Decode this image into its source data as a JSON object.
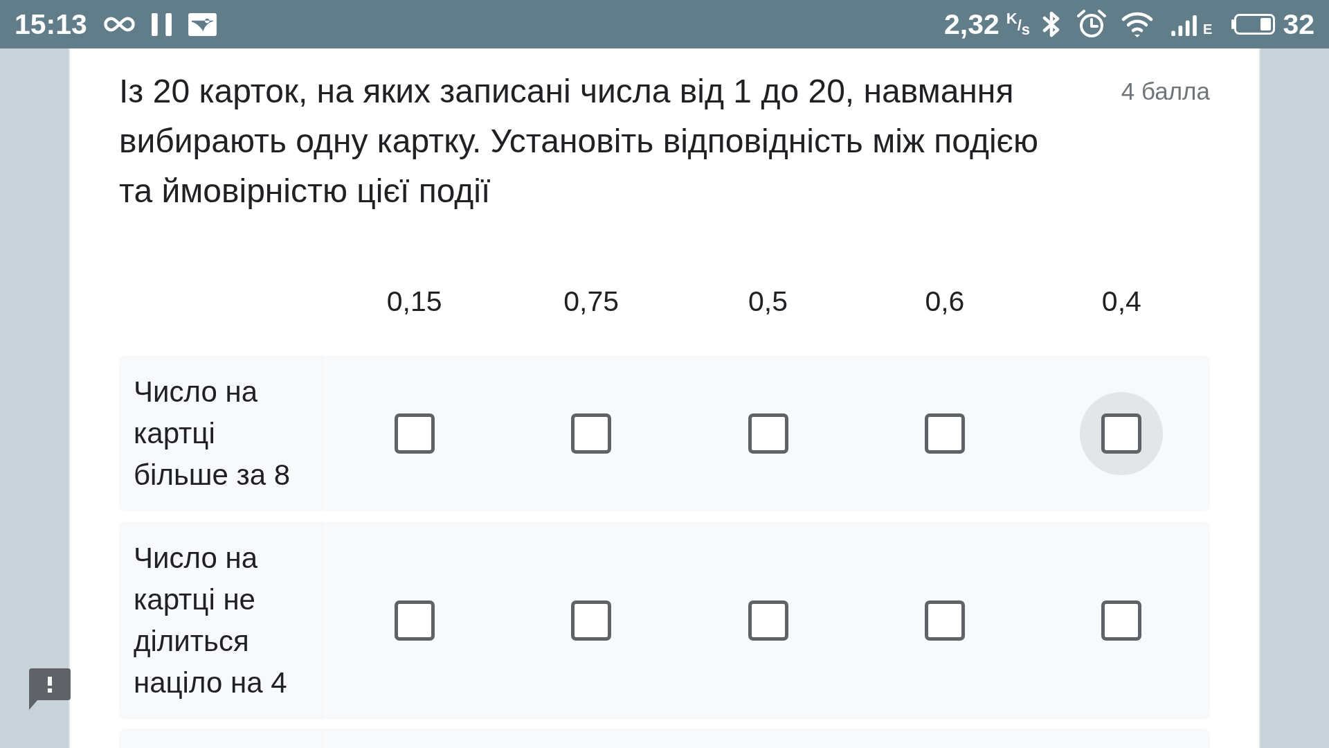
{
  "status_bar": {
    "time": "15:13",
    "net_speed": "2,32",
    "speed_unit": "$^{K}$/$_{s}$",
    "network_type": "E",
    "battery_percent": "32"
  },
  "question": {
    "text": "Із 20 карток, на яких записані числа від 1 до 20, навмання вибирають одну картку. Установіть відповідність між подією та ймовірністю цієї події",
    "points": "4 балла"
  },
  "grid": {
    "columns": [
      "0,15",
      "0,75",
      "0,5",
      "0,6",
      "0,4"
    ],
    "rows": [
      {
        "label": "Число на картці більше за 8",
        "cells": [
          {
            "checked": false,
            "focused": false
          },
          {
            "checked": false,
            "focused": false
          },
          {
            "checked": false,
            "focused": false
          },
          {
            "checked": false,
            "focused": false
          },
          {
            "checked": false,
            "focused": true
          }
        ]
      },
      {
        "label": "Число на картці не ділиться націло на 4",
        "cells": [
          {
            "checked": false,
            "focused": false
          },
          {
            "checked": false,
            "focused": false
          },
          {
            "checked": false,
            "focused": false
          },
          {
            "checked": false,
            "focused": false
          },
          {
            "checked": false,
            "focused": false
          }
        ]
      }
    ]
  }
}
